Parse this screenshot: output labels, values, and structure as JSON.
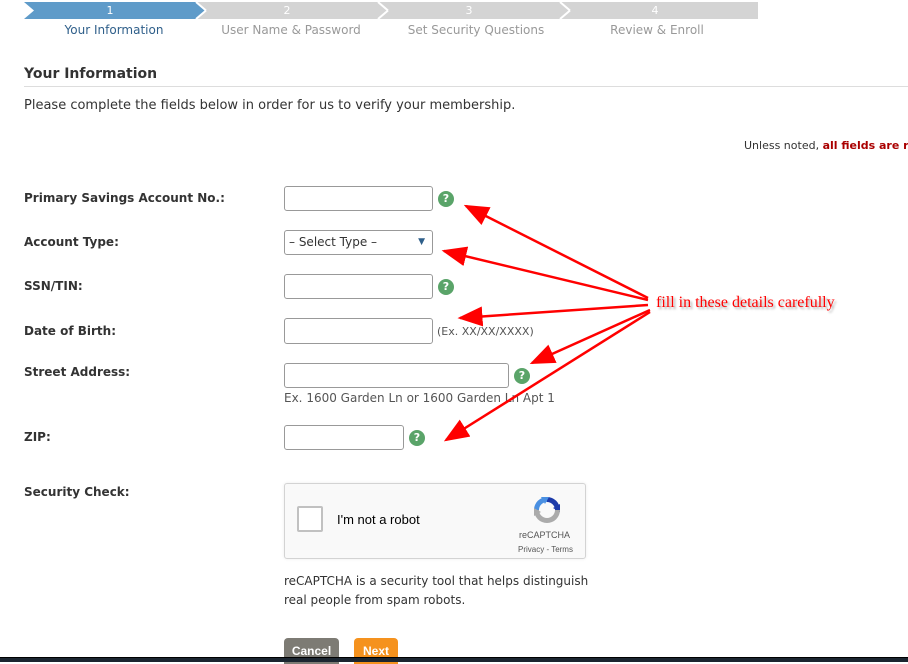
{
  "wizard": {
    "steps": [
      {
        "number": "1",
        "label": "Your Information",
        "active": true
      },
      {
        "number": "2",
        "label": "User Name & Password",
        "active": false
      },
      {
        "number": "3",
        "label": "Set Security Questions",
        "active": false
      },
      {
        "number": "4",
        "label": "Review & Enroll",
        "active": false
      }
    ],
    "colors": {
      "active": "#5f9bc9",
      "inactive": "#d4d4d4"
    }
  },
  "page": {
    "title": "Your Information",
    "intro": "Please complete the fields below in order for us to verify your membership.",
    "required_note_prefix": "Unless noted, ",
    "required_note_emphasis": "all fields are req"
  },
  "form": {
    "fields": [
      {
        "label": "Primary Savings Account No.:",
        "value": "",
        "help": "?"
      },
      {
        "label": "Account Type:",
        "selected": "– Select Type –"
      },
      {
        "label": "SSN/TIN:",
        "value": "",
        "help": "?"
      },
      {
        "label": "Date of Birth:",
        "value": "",
        "hint": "(Ex. XX/XX/XXXX)"
      },
      {
        "label": "Street Address:",
        "value": "",
        "help": "?",
        "hint": "Ex. 1600 Garden Ln or 1600 Garden Ln Apt 1"
      },
      {
        "label": "ZIP:",
        "value": "",
        "help": "?"
      }
    ],
    "security_check": {
      "label": "Security Check:",
      "checkbox_label": "I'm not a robot",
      "brand": "reCAPTCHA",
      "links": "Privacy - Terms",
      "description": "reCAPTCHA is a security tool that helps distinguish real people from spam robots."
    },
    "buttons": {
      "cancel": "Cancel",
      "next": "Next"
    }
  },
  "annotation": {
    "text": "fill in these details carefully",
    "color": "#ff0000"
  }
}
